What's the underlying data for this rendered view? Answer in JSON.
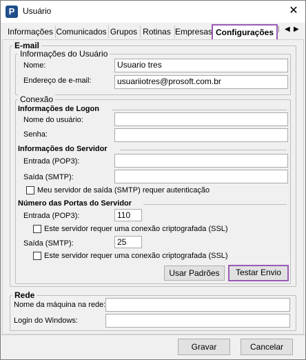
{
  "window": {
    "title": "Usuário",
    "close": "✕"
  },
  "tabs": [
    "Informações",
    "Comunicados",
    "Grupos",
    "Rotinas",
    "Empresas",
    "Configurações"
  ],
  "tab_nav": {
    "left": "◀",
    "right": "▶"
  },
  "email": {
    "title": "E-mail",
    "user_info_title": "Informações do Usuário",
    "name_label": "Nome:",
    "name_value": "Usuario tres",
    "email_label": "Endereço de e-mail:",
    "email_value": "usuariiotres@prosoft.com.br",
    "connection_title": "Conexão",
    "logon_title": "Informações de Logon",
    "username_label": "Nome do usuário:",
    "password_label": "Senha:",
    "server_title": "Informações do Servidor",
    "pop3_label": "Entrada (POP3):",
    "smtp_label": "Saída (SMTP):",
    "auth_label": "Meu servidor de saída (SMTP) requer autenticação",
    "ports_title": "Número das Portas do Servidor",
    "pop3_port_label": "Entrada (POP3):",
    "pop3_port_value": "110",
    "ssl1_label": "Este servidor requer uma conexão criptografada (SSL)",
    "smtp_port_label": "Saída (SMTP):",
    "smtp_port_value": "25",
    "ssl2_label": "Este servidor requer uma conexão criptografada (SSL)",
    "defaults_button": "Usar Padrões",
    "test_button": "Testar Envio"
  },
  "network": {
    "title": "Rede",
    "machine_label": "Nome da máquina na rede:",
    "windows_login_label": "Login do Windows:"
  },
  "footer": {
    "save": "Gravar",
    "cancel": "Cancelar"
  }
}
